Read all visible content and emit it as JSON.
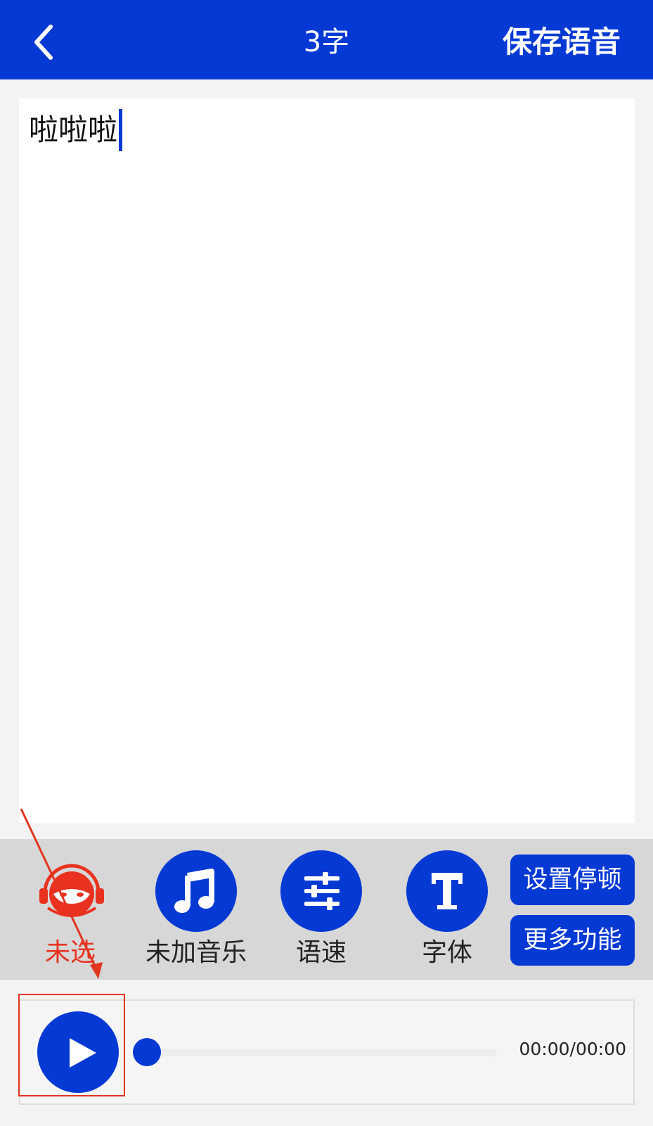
{
  "header": {
    "title": "3字",
    "save_label": "保存语音",
    "back_icon": "chevron-left-icon",
    "background_color": "#0539d4"
  },
  "editor": {
    "text": "啦啦啦"
  },
  "toolbar": {
    "voice": {
      "label": "未选",
      "icon": "headset-avatar-icon",
      "color": "#e8321f"
    },
    "music": {
      "label": "未加音乐",
      "icon": "music-note-icon"
    },
    "speed": {
      "label": "语速",
      "icon": "sliders-icon"
    },
    "font": {
      "label": "字体",
      "icon": "text-t-icon"
    },
    "pause_button": "设置停顿",
    "more_button": "更多功能"
  },
  "player": {
    "time": "00:00/00:00",
    "progress": 0,
    "play_icon": "play-icon"
  },
  "annotation": {
    "color": "#e2351f"
  }
}
